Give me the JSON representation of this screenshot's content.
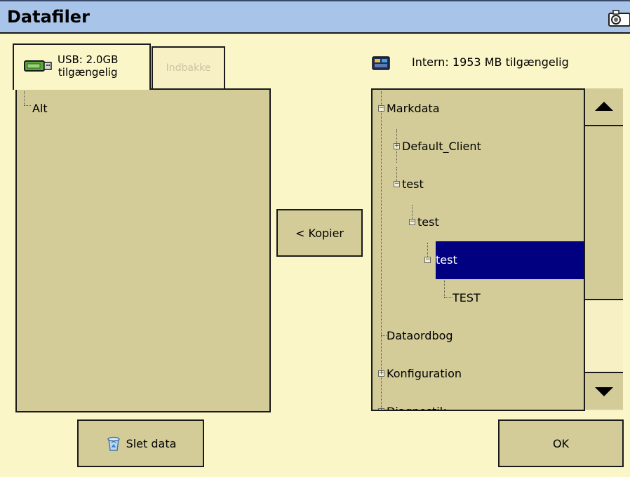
{
  "window": {
    "title": "Datafiler"
  },
  "tabs": {
    "usb_label_line1": "USB: 2.0GB",
    "usb_label_line2": "tilgængelig",
    "inbox_label": "Indbakke"
  },
  "left_tree": {
    "root": "Alt"
  },
  "internal": {
    "label": "Intern: 1953 MB tilgængelig"
  },
  "right_tree": {
    "items": [
      {
        "label": "Markdata",
        "expander": "−"
      },
      {
        "label": "Default_Client",
        "expander": "+"
      },
      {
        "label": "test",
        "expander": "−"
      },
      {
        "label": "test",
        "expander": "−"
      },
      {
        "label": "test",
        "expander": "−",
        "selected": true
      },
      {
        "label": "TEST",
        "expander": ""
      },
      {
        "label": "Dataordbog",
        "expander": ""
      },
      {
        "label": "Konfiguration",
        "expander": "+"
      },
      {
        "label": "Diagnostik",
        "expander": "+"
      }
    ]
  },
  "buttons": {
    "copy": "< Kopier",
    "delete": "Slet data",
    "ok": "OK"
  },
  "icons": {
    "camera": "camera-icon",
    "usb": "usb-drive-icon",
    "internal": "display-icon",
    "trash": "recycle-bin-icon",
    "scroll_up": "triangle-up-icon",
    "scroll_down": "triangle-down-icon"
  },
  "colors": {
    "background": "#fbf6c8",
    "titlebar": "#a8c4e8",
    "panel": "#d3cc98",
    "selection": "#000080"
  }
}
